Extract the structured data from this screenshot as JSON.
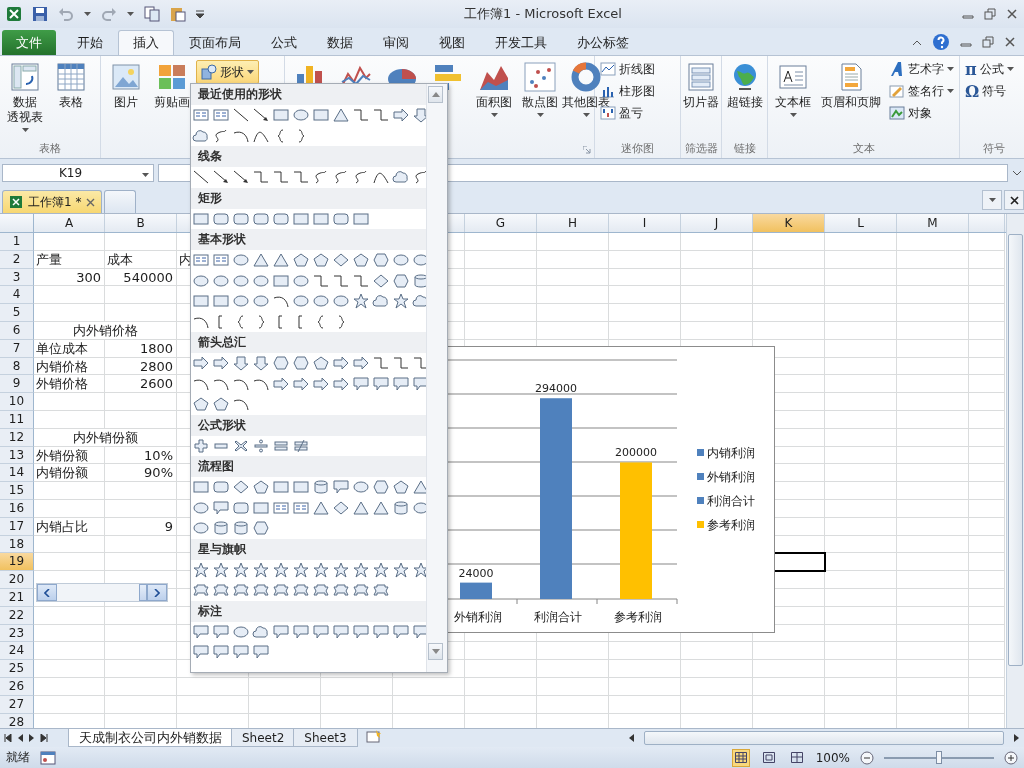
{
  "window": {
    "title": "工作簿1  -  Microsoft Excel"
  },
  "ribbon_tabs": [
    {
      "label": "文件",
      "kind": "file",
      "selected": false
    },
    {
      "label": "开始",
      "kind": "tab",
      "selected": false
    },
    {
      "label": "插入",
      "kind": "tab",
      "selected": true
    },
    {
      "label": "页面布局",
      "kind": "tab",
      "selected": false
    },
    {
      "label": "公式",
      "kind": "tab",
      "selected": false
    },
    {
      "label": "数据",
      "kind": "tab",
      "selected": false
    },
    {
      "label": "审阅",
      "kind": "tab",
      "selected": false
    },
    {
      "label": "视图",
      "kind": "tab",
      "selected": false
    },
    {
      "label": "开发工具",
      "kind": "tab",
      "selected": false
    },
    {
      "label": "办公标签",
      "kind": "tab",
      "selected": false
    }
  ],
  "ribbon": {
    "groups": [
      {
        "label": "表格",
        "items": [
          {
            "kind": "large",
            "lines": [
              "数据",
              "透视表"
            ],
            "dropdown": true
          },
          {
            "kind": "large",
            "lines": [
              "表格"
            ]
          }
        ]
      },
      {
        "items": [
          {
            "kind": "large",
            "lines": [
              "图片"
            ]
          },
          {
            "kind": "large",
            "lines": [
              "剪贴画"
            ]
          },
          {
            "kind": "menu",
            "lines": [
              "形状"
            ],
            "dropdown": true,
            "selected": true
          }
        ]
      },
      {
        "launcher": true,
        "items": [
          {
            "kind": "large"
          },
          {
            "kind": "large"
          },
          {
            "kind": "large"
          },
          {
            "kind": "large"
          },
          {
            "kind": "large",
            "lines": [
              "面积图"
            ],
            "dropdown": true
          },
          {
            "kind": "large",
            "lines": [
              "散点图"
            ],
            "dropdown": true
          },
          {
            "kind": "large",
            "lines": [
              "其他图表"
            ],
            "dropdown": true
          }
        ]
      },
      {
        "label": "迷你图",
        "items": [
          {
            "kind": "small",
            "lines": [
              "折线图"
            ]
          },
          {
            "kind": "small",
            "lines": [
              "柱形图"
            ]
          },
          {
            "kind": "small",
            "lines": [
              "盈亏"
            ]
          }
        ]
      },
      {
        "label": "筛选器",
        "items": [
          {
            "kind": "large",
            "lines": [
              "切片器"
            ]
          }
        ]
      },
      {
        "label": "链接",
        "items": [
          {
            "kind": "large",
            "lines": [
              "超链接"
            ]
          }
        ]
      },
      {
        "label": "文本",
        "items": [
          {
            "kind": "large",
            "lines": [
              "文本框"
            ],
            "dropdown": true
          },
          {
            "kind": "large",
            "lines": [
              "页眉和页脚"
            ]
          },
          {
            "kind": "small",
            "lines": [
              "艺术字"
            ],
            "dropdown": true
          },
          {
            "kind": "small",
            "lines": [
              "签名行"
            ],
            "dropdown": true
          },
          {
            "kind": "small",
            "lines": [
              "对象"
            ]
          }
        ]
      },
      {
        "label": "符号",
        "items": [
          {
            "kind": "small",
            "glyph": "π",
            "lines": [
              "公式"
            ],
            "dropdown": true
          },
          {
            "kind": "small",
            "glyph": "Ω",
            "lines": [
              "符号"
            ]
          }
        ]
      }
    ]
  },
  "formula_bar": {
    "name_box": "K19"
  },
  "workbook_tabs": [
    {
      "label": "工作簿1 *",
      "selected": true
    },
    {
      "selected": false
    }
  ],
  "columns": [
    {
      "label": "A",
      "selected": false
    },
    {
      "label": "B",
      "selected": false
    },
    {},
    {},
    {},
    {
      "selected": false
    },
    {
      "label": "G",
      "selected": false
    },
    {
      "label": "H",
      "selected": false
    },
    {
      "label": "I",
      "selected": false
    },
    {
      "label": "J",
      "selected": false
    },
    {
      "label": "K",
      "selected": true
    },
    {
      "label": "L",
      "selected": false
    },
    {
      "label": "M",
      "selected": false
    },
    {
      "selected": false
    }
  ],
  "rows": [
    {
      "number": "1",
      "selected": false
    },
    {
      "number": "2",
      "selected": false,
      "a": {
        "kind": "text",
        "text": "产量"
      },
      "b": {
        "kind": "text",
        "text": "成本"
      },
      "c": {
        "kind": "text",
        "text": "内"
      }
    },
    {
      "number": "3",
      "selected": false,
      "a": {
        "kind": "number",
        "text": "300"
      },
      "b": {
        "kind": "number",
        "text": "540000"
      }
    },
    {
      "number": "4",
      "selected": false
    },
    {
      "number": "5",
      "selected": false
    },
    {
      "number": "6",
      "selected": false,
      "ab": {
        "kind": "title",
        "text": "内外销价格"
      }
    },
    {
      "number": "7",
      "selected": false,
      "a": {
        "kind": "text",
        "text": "单位成本"
      },
      "b": {
        "kind": "number",
        "text": "1800"
      }
    },
    {
      "number": "8",
      "selected": false,
      "a": {
        "kind": "text",
        "text": "内销价格"
      },
      "b": {
        "kind": "number",
        "text": "2800"
      }
    },
    {
      "number": "9",
      "selected": false,
      "a": {
        "kind": "text",
        "text": "外销价格"
      },
      "b": {
        "kind": "number",
        "text": "2600"
      }
    },
    {
      "number": "10",
      "selected": false
    },
    {
      "number": "11",
      "selected": false
    },
    {
      "number": "12",
      "selected": false,
      "ab": {
        "kind": "title",
        "text": "内外销份额"
      }
    },
    {
      "number": "13",
      "selected": false,
      "a": {
        "kind": "text",
        "text": "外销份额"
      },
      "b": {
        "kind": "number",
        "text": "10%"
      }
    },
    {
      "number": "14",
      "selected": false,
      "a": {
        "kind": "text",
        "text": "内销份额"
      },
      "b": {
        "kind": "number",
        "text": "90%"
      }
    },
    {
      "number": "15",
      "selected": false
    },
    {
      "number": "16",
      "selected": false
    },
    {
      "number": "17",
      "selected": false,
      "a": {
        "kind": "text",
        "text": "内销占比"
      },
      "b": {
        "kind": "number",
        "text": "9"
      }
    },
    {
      "number": "18",
      "selected": false
    },
    {
      "number": "19",
      "selected": true
    },
    {
      "number": "20",
      "selected": false
    },
    {
      "number": "21",
      "selected": false
    },
    {
      "number": "22",
      "selected": false
    },
    {
      "number": "23",
      "selected": false
    },
    {
      "number": "24",
      "selected": false
    },
    {
      "number": "25",
      "selected": false
    },
    {
      "number": "26",
      "selected": false
    },
    {
      "number": "27",
      "selected": false
    },
    {
      "number": "28",
      "selected": false
    }
  ],
  "chart": {
    "chart_data": {
      "type": "bar",
      "categories": [
        "外销利润",
        "利润合计",
        "参考利润"
      ],
      "series": [
        {
          "values": [
            24000,
            294000,
            200000
          ]
        }
      ],
      "data_labels": true
    },
    "legend": [
      {
        "label": "内销利润",
        "color": "#4f81bd"
      },
      {
        "label": "外销利润",
        "color": "#4f81bd"
      },
      {
        "label": "利润合计",
        "color": "#4f81bd"
      },
      {
        "label": "参考利润",
        "color": "#ffc000"
      }
    ]
  },
  "shapes_menu": {
    "sections": [
      {
        "title": "最近使用的形状"
      },
      {
        "title": "线条"
      },
      {
        "title": "矩形"
      },
      {
        "title": "基本形状"
      },
      {
        "title": "箭头总汇"
      },
      {
        "title": "公式形状"
      },
      {
        "title": "流程图"
      },
      {
        "title": "星与旗帜"
      },
      {
        "title": "标注"
      }
    ]
  },
  "sheet_tabs": [
    {
      "label": "天成制衣公司内外销数据",
      "selected": true
    },
    {
      "label": "Sheet2",
      "selected": false
    },
    {
      "label": "Sheet3",
      "selected": false
    }
  ],
  "status_bar": {
    "status": "就绪",
    "views": [
      {
        "selected": true
      },
      {
        "selected": false
      },
      {
        "selected": false
      }
    ],
    "zoom": "100%",
    "zoom_slider": {
      "level": 0.5
    }
  }
}
